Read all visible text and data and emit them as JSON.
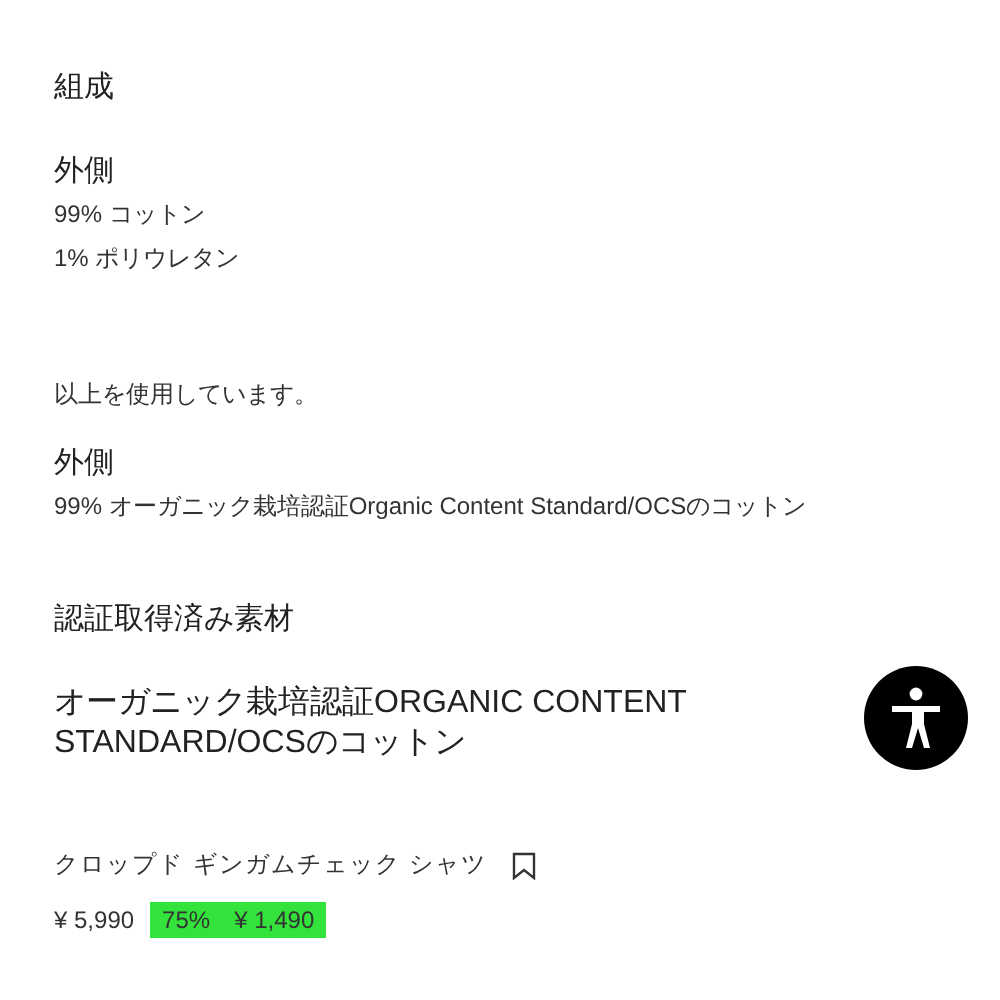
{
  "composition": {
    "title": "組成",
    "groups": [
      {
        "heading": "外側",
        "lines": [
          "99% コットン",
          "1% ポリウレタン"
        ]
      }
    ]
  },
  "usage_note": "以上を使用しています。",
  "usage_groups": [
    {
      "heading": "外側",
      "lines": [
        "99% オーガニック栽培認証Organic Content Standard/OCSのコットン"
      ]
    }
  ],
  "certified": {
    "title": "認証取得済み素材",
    "material": "オーガニック栽培認証ORGANIC CONTENT STANDARD/OCSのコットン"
  },
  "product": {
    "name": "クロップド ギンガムチェック シャツ",
    "bookmarked": false,
    "original_price": "¥ 5,990",
    "discount": "75%",
    "sale_price": "¥ 1,490"
  }
}
